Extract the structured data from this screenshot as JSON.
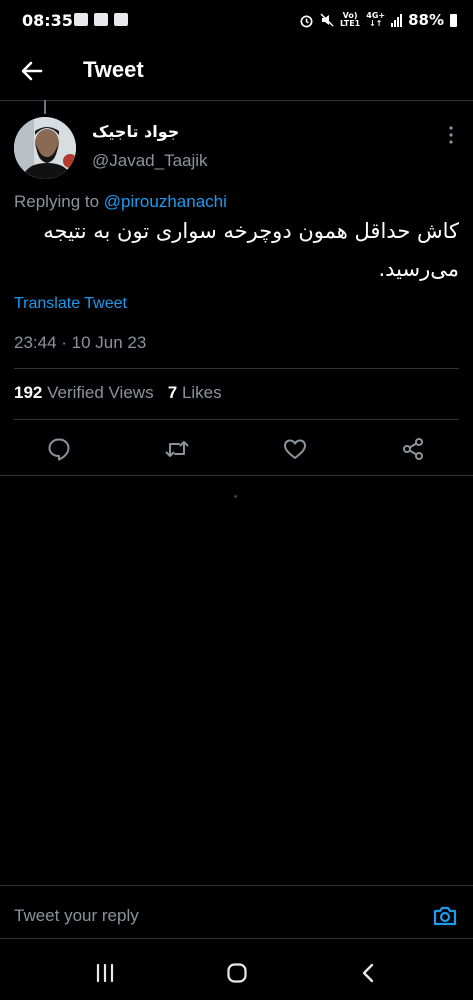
{
  "status_bar": {
    "time": "08:35",
    "volte": "Vo)",
    "lte": "LTE1",
    "network": "4G+",
    "battery": "88%"
  },
  "header": {
    "title": "Tweet"
  },
  "tweet": {
    "author_name": "جواد تاجیک",
    "author_handle": "@Javad_Taajik",
    "replying_prefix": "Replying to ",
    "replying_to": "@pirouzhanachi",
    "text": "کاش حداقل همون دوچرخه سواری تون به نتیجه می‌رسید.",
    "translate_label": "Translate Tweet",
    "timestamp": "23:44 · 10 Jun 23",
    "views_count": "192",
    "views_label": " Verified Views",
    "likes_count": "7",
    "likes_label": " Likes"
  },
  "reply": {
    "placeholder": "Tweet your reply"
  },
  "icons": {
    "back": "arrow-left-icon",
    "more": "more-vertical-icon",
    "reply": "comment-icon",
    "retweet": "retweet-icon",
    "like": "heart-icon",
    "share": "share-icon",
    "camera": "camera-icon"
  },
  "colors": {
    "background": "#000000",
    "accent": "#1d9bf0",
    "secondary_text": "#8b949b",
    "divider": "#2f3336"
  }
}
